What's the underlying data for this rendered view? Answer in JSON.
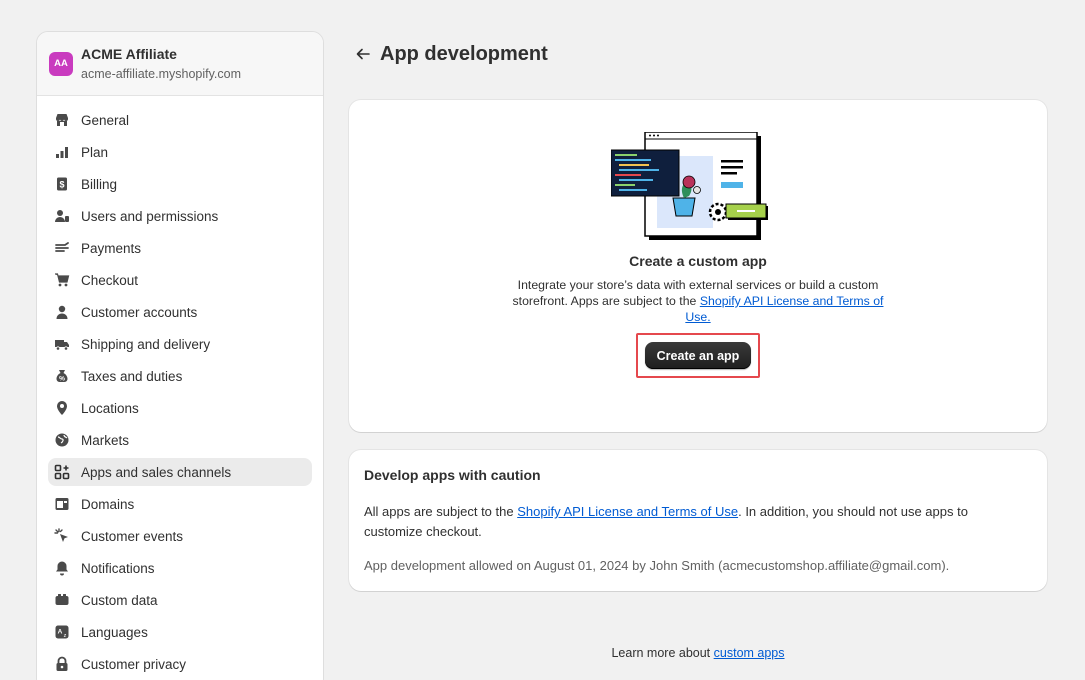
{
  "store": {
    "initials": "AA",
    "name": "ACME Affiliate",
    "url": "acme-affiliate.myshopify.com"
  },
  "nav": [
    {
      "label": "General",
      "icon": "store-icon"
    },
    {
      "label": "Plan",
      "icon": "plan-icon"
    },
    {
      "label": "Billing",
      "icon": "billing-icon"
    },
    {
      "label": "Users and permissions",
      "icon": "users-icon"
    },
    {
      "label": "Payments",
      "icon": "payments-icon"
    },
    {
      "label": "Checkout",
      "icon": "cart-icon"
    },
    {
      "label": "Customer accounts",
      "icon": "person-icon"
    },
    {
      "label": "Shipping and delivery",
      "icon": "truck-icon"
    },
    {
      "label": "Taxes and duties",
      "icon": "taxes-icon"
    },
    {
      "label": "Locations",
      "icon": "location-icon"
    },
    {
      "label": "Markets",
      "icon": "globe-icon"
    },
    {
      "label": "Apps and sales channels",
      "icon": "apps-icon",
      "active": true
    },
    {
      "label": "Domains",
      "icon": "domains-icon"
    },
    {
      "label": "Customer events",
      "icon": "cursor-icon"
    },
    {
      "label": "Notifications",
      "icon": "bell-icon"
    },
    {
      "label": "Custom data",
      "icon": "database-icon"
    },
    {
      "label": "Languages",
      "icon": "language-icon"
    },
    {
      "label": "Customer privacy",
      "icon": "lock-icon"
    }
  ],
  "page": {
    "title": "App development"
  },
  "custom_app": {
    "title": "Create a custom app",
    "desc_prefix": "Integrate your store’s data with external services or build a custom storefront. Apps are subject to the ",
    "desc_link": "Shopify API License and Terms of Use.",
    "button": "Create an app"
  },
  "caution": {
    "title": "Develop apps with caution",
    "text_prefix": "All apps are subject to the ",
    "text_link": "Shopify API License and Terms of Use",
    "text_suffix": ". In addition, you should not use apps to customize checkout.",
    "allowed": "App development allowed on August 01, 2024 by John Smith (acmecustomshop.affiliate@gmail.com)."
  },
  "footer": {
    "prefix": "Learn more about ",
    "link": "custom apps"
  },
  "colors": {
    "avatar": "#c93bbf",
    "link": "#005bd3",
    "highlight": "#e5484d",
    "button": "#303030"
  }
}
